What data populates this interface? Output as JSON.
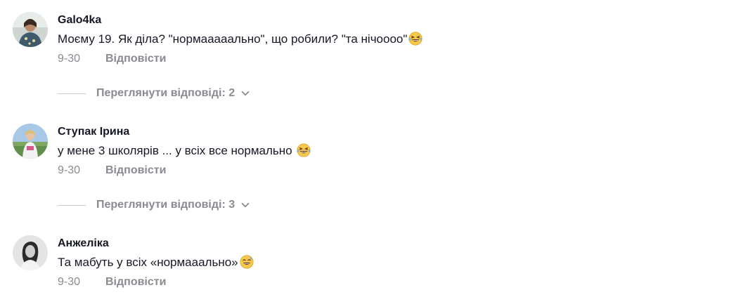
{
  "comments": [
    {
      "username": "Galo4ka",
      "text": "Моєму 19. Як діла? \"нормааааально\", що робили? \"та нічоооо\"",
      "emoji": "grinning-squinting-tears-emoji",
      "date": "9-30",
      "reply_label": "Відповісти",
      "view_replies": "Переглянути відповіді: 2"
    },
    {
      "username": "Ступак Ірина",
      "text": "у мене 3 школярів ... у всіх все нормально",
      "emoji": "grinning-squinting-tears-emoji",
      "date": "9-30",
      "reply_label": "Відповісти",
      "view_replies": "Переглянути відповіді: 3"
    },
    {
      "username": "Анжеліка",
      "text": "Та мабуть у всіх «нормааально»",
      "emoji": "grinning-sweat-emoji",
      "date": "9-30",
      "reply_label": "Відповісти"
    }
  ],
  "colors": {
    "text": "#161823",
    "muted": "#8a8b91",
    "divider": "#c7c8cc"
  }
}
